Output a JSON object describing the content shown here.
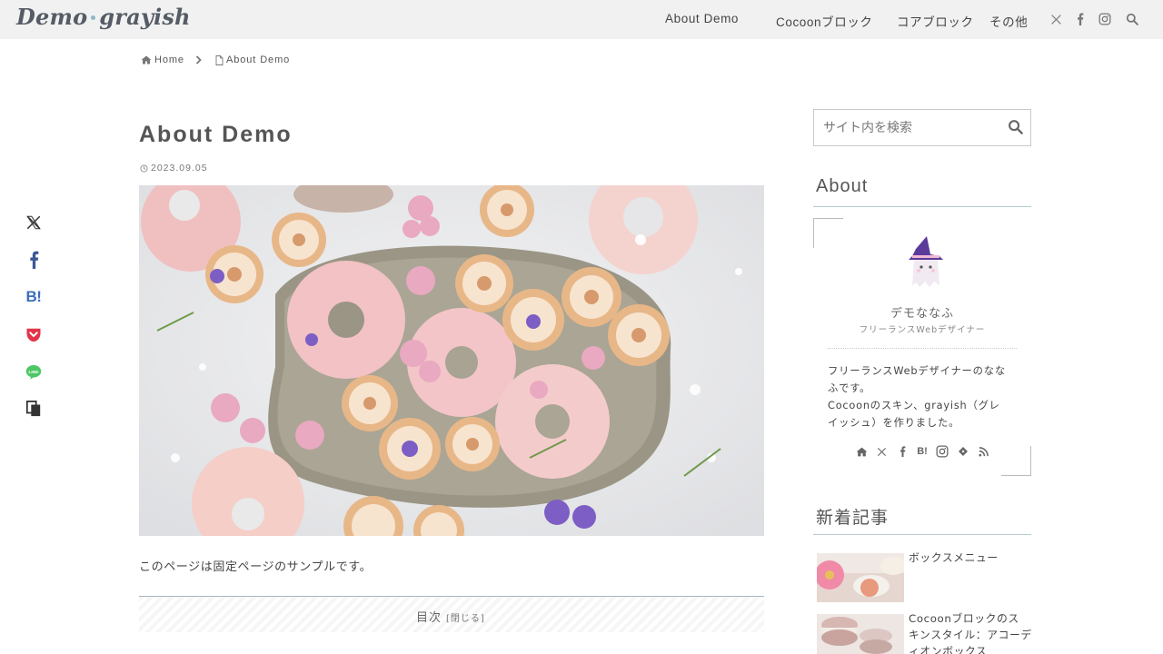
{
  "site": {
    "logo_left": "Demo",
    "logo_right": "grayish"
  },
  "nav": {
    "items": [
      {
        "label": "About Demo"
      },
      {
        "label": "Cocoonブロック"
      },
      {
        "label": "コアブロック"
      },
      {
        "label": "その他"
      }
    ],
    "icons": [
      "x-icon",
      "facebook-icon",
      "instagram-icon",
      "search-icon"
    ]
  },
  "breadcrumb": {
    "home": "Home",
    "current": "About Demo"
  },
  "article": {
    "title": "About Demo",
    "date": "2023.09.05",
    "intro": "このページは固定ページのサンプルです。"
  },
  "toc": {
    "title": "目次",
    "toggle": "[閉じる]"
  },
  "share": [
    "x-icon",
    "facebook-icon",
    "hatena-bookmark-icon",
    "pocket-icon",
    "line-icon",
    "copy-icon"
  ],
  "sidebar": {
    "search_placeholder": "サイト内を検索",
    "about": {
      "title": "About",
      "name": "デモななふ",
      "role": "フリーランスWebデザイナー",
      "bio_lines": [
        "フリーランスWebデザイナーのなな",
        "ふです。",
        "Cocoonのスキン、grayish（グレ",
        "イッシュ）を作りました。"
      ],
      "social_icons": [
        "home-icon",
        "x-icon",
        "facebook-icon",
        "hatena-icon",
        "instagram-icon",
        "feedly-icon",
        "rss-icon"
      ]
    },
    "recent": {
      "title": "新着記事",
      "posts": [
        {
          "title_lines": [
            "ボックスメニュー"
          ]
        },
        {
          "title_lines": [
            "Cocoonブロックのス",
            "キンスタイル：アコーデ",
            "ィオンボックス"
          ]
        }
      ]
    }
  },
  "colors": {
    "header_bg": "#f1f1f1",
    "accent_line": "#b7cbd1",
    "pocket": "#e2334a",
    "line": "#4cc764",
    "hatena": "#3a6fb7"
  }
}
